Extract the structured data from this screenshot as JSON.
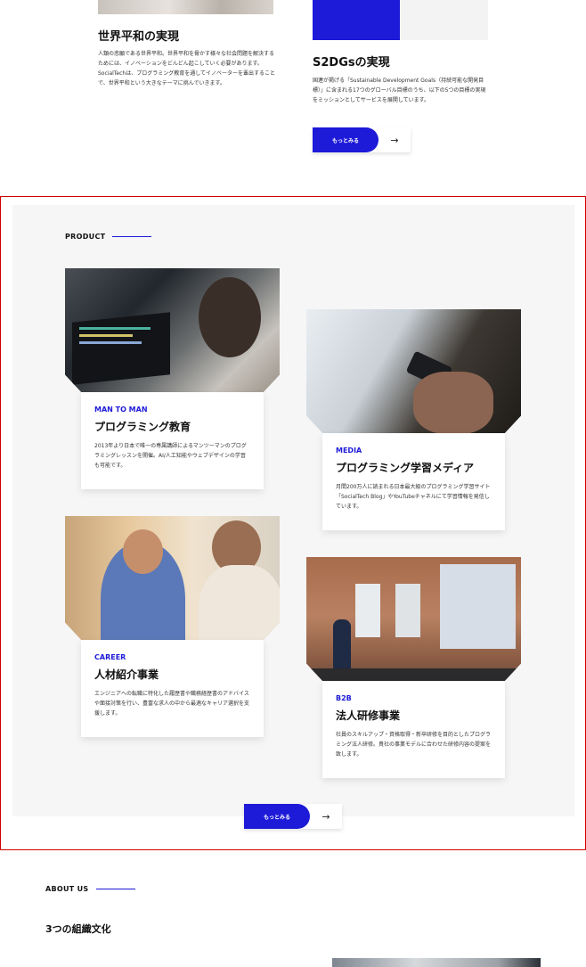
{
  "top": {
    "peace": {
      "title": "世界平和の実現",
      "body": "人類の悲願である世界平和。世界平和を脅かす様々な社会問題を解決するためには、イノベーションをどんどん起こしていく必要があります。SocialTechは、プログラミング教育を通してイノベーターを輩出することで、世界平和という大きなテーマに挑んでいきます。"
    },
    "sdgs": {
      "title": "S2DGsの実現",
      "body": "国連が掲げる「Sustainable Development Goals（持続可能な開発目標）」に含まれる17つのグローバル目標のうち、以下の5つの目標の実現をミッションとしてサービスを展開しています。"
    },
    "more_label": "もっとみる",
    "arrow": "→"
  },
  "product": {
    "label": "PRODUCT",
    "cards": [
      {
        "category": "MAN TO MAN",
        "title": "プログラミング教育",
        "description": "2013年より日本で唯一の専属講師によるマンツーマンのプログラミングレッスンを開催。AI/人工知能やウェブデザインの学習も可能です。"
      },
      {
        "category": "MEDIA",
        "title": "プログラミング学習メディア",
        "description": "月間200万人に読まれる日本最大級のプログラミング学習サイト「SocialTech Blog」やYouTubeチャネルにて学習情報を発信しています。"
      },
      {
        "category": "CAREER",
        "title": "人材紹介事業",
        "description": "エンジニアへの転職に特化した履歴書や職務経歴書のアドバイスや面接対策を行い、豊富な求人の中から最適なキャリア選択を支援します。"
      },
      {
        "category": "B2B",
        "title": "法人研修事業",
        "description": "社員のスキルアップ・資格取得・新卒研修を目的としたプログラミング法人研修。貴社の事業モデルに合わせた研修内容の提案を致します。"
      }
    ],
    "more_label": "もっとみる",
    "arrow": "→"
  },
  "about": {
    "label": "ABOUT US",
    "heading": "3つの組織文化"
  },
  "colors": {
    "accent": "#1d1ad8",
    "highlight_border": "#d30000",
    "section_bg": "#f6f6f7"
  }
}
